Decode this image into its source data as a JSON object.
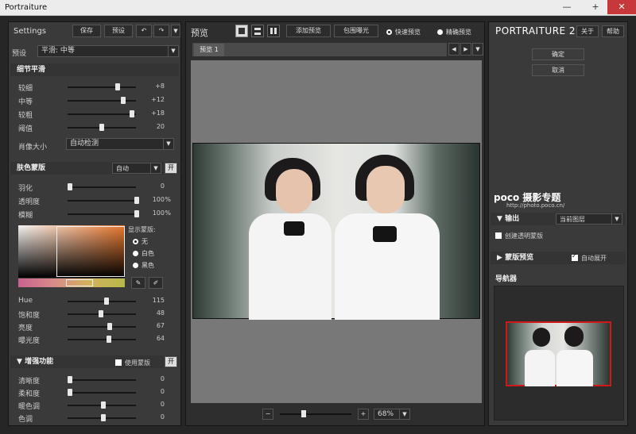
{
  "window": {
    "title": "Portraiture",
    "minimize": "—",
    "maximize": "+",
    "close": "✕"
  },
  "left": {
    "settings_label": "Settings",
    "save": "保存",
    "preset_btn": "预设",
    "preset_label": "预设",
    "preset_value": "平滑: 中等",
    "detail": {
      "title": "细节平滑",
      "rows": [
        {
          "label": "较细",
          "value": "+8",
          "pos": 0.72
        },
        {
          "label": "中等",
          "value": "+12",
          "pos": 0.8
        },
        {
          "label": "较粗",
          "value": "+18",
          "pos": 0.93
        },
        {
          "label": "阈值",
          "value": "20",
          "pos": 0.48
        }
      ],
      "size_label": "肖像大小",
      "size_value": "自动检测"
    },
    "mask": {
      "title": "肤色蒙版",
      "auto": "自动",
      "on": "开",
      "rows": [
        {
          "label": "羽化",
          "value": "0",
          "pos": 0.0
        },
        {
          "label": "透明度",
          "value": "100",
          "unit": "%",
          "pos": 1.0
        },
        {
          "label": "模糊",
          "value": "100",
          "unit": "%",
          "pos": 1.0
        }
      ],
      "show_label": "显示蒙版:",
      "options": [
        "无",
        "白色",
        "黑色"
      ],
      "hsl": [
        {
          "label": "Hue",
          "value": "115",
          "pos": 0.55
        },
        {
          "label": "饱和度",
          "value": "48",
          "pos": 0.47
        },
        {
          "label": "亮度",
          "value": "67",
          "pos": 0.6
        },
        {
          "label": "曝光度",
          "value": "64",
          "pos": 0.58
        }
      ]
    },
    "enhance": {
      "title": "增强功能",
      "use_mask": "使用蒙版",
      "on": "开",
      "rows": [
        {
          "label": "清晰度",
          "value": "0",
          "pos": 0.0
        },
        {
          "label": "柔和度",
          "value": "0",
          "pos": 0.0
        },
        {
          "label": "暖色调",
          "value": "0",
          "pos": 0.5
        },
        {
          "label": "色调",
          "value": "0",
          "pos": 0.5
        }
      ]
    }
  },
  "center": {
    "preview_label": "预览",
    "add_preview": "添加预览",
    "clip_exposure": "包围曝光",
    "fast_preview": "快速预览",
    "precise_preview": "精确预览",
    "tab": "预览 1",
    "zoom": "68%",
    "zoom_minus": "−",
    "zoom_plus": "+"
  },
  "right": {
    "brand": "PORTRAITURE 2",
    "about": "关于",
    "help": "帮助",
    "ok": "确定",
    "cancel": "取消",
    "watermark": "poco 摄影专题",
    "watermark_url": "http://photo.poco.cn/",
    "output": {
      "title": "输出",
      "value": "当前图层",
      "create_mask": "创建透明蒙版"
    },
    "mask_preview": {
      "title": "蒙版预览",
      "auto_expand": "自动展开"
    },
    "navigator": {
      "title": "导航器"
    }
  }
}
